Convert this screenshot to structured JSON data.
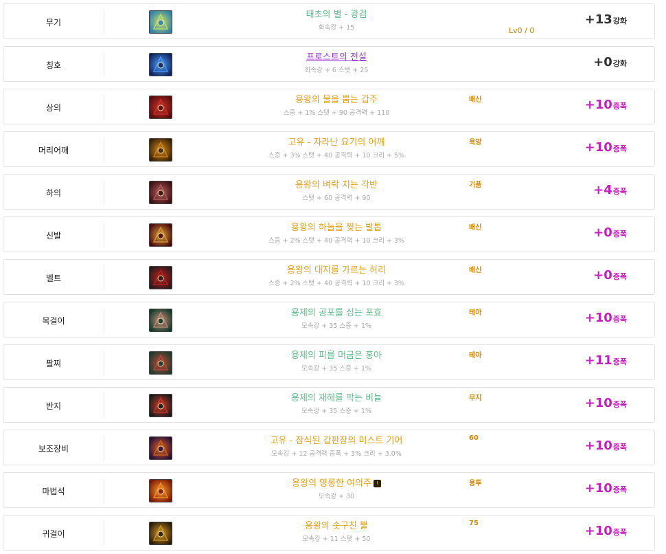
{
  "rows": [
    {
      "slot": "무기",
      "name": "태초의 별 - 광검",
      "name_color": "green",
      "stats": "화속강 + 15",
      "option": "",
      "level": "Lv0 / 0",
      "enhance": "+13",
      "unit": "강화",
      "enh_color": "black",
      "icon": "weapon-icon",
      "c1": "#2f7fa8",
      "c2": "#c9e36a",
      "warning": false
    },
    {
      "slot": "칭호",
      "name": "프로스트의 전설",
      "name_color": "purple",
      "stats": "화속강 + 6 스탯 + 25",
      "option": "",
      "level": "",
      "enhance": "+0",
      "unit": "강화",
      "enh_color": "black",
      "icon": "title-icon",
      "c1": "#10245e",
      "c2": "#4fa0ff",
      "warning": false
    },
    {
      "slot": "상의",
      "name": "용왕의 불을 뿜는 갑주",
      "name_color": "gold",
      "stats": "스증 + 1% 스탯 + 90 공격력 + 110",
      "option": "배신",
      "level": "",
      "enhance": "+10",
      "unit": "증폭",
      "enh_color": "magenta",
      "icon": "top-armor-icon",
      "c1": "#5a0d0d",
      "c2": "#d0342c",
      "warning": false
    },
    {
      "slot": "머리어깨",
      "name": "고유 - 자라난 요기의 어깨",
      "name_color": "gold",
      "stats": "스증 + 3% 스탯 + 40 공격력 + 10 크리 + 5%",
      "option": "욕망",
      "level": "",
      "enhance": "+10",
      "unit": "증폭",
      "enh_color": "magenta",
      "icon": "shoulder-icon",
      "c1": "#3a2206",
      "c2": "#d98a1c",
      "warning": false
    },
    {
      "slot": "하의",
      "name": "용왕의 벼락 치는 각반",
      "name_color": "gold",
      "stats": "스탯 + 60 공격력 + 90",
      "option": "기품",
      "level": "",
      "enhance": "+4",
      "unit": "증폭",
      "enh_color": "magenta",
      "icon": "pants-icon",
      "c1": "#3b1010",
      "c2": "#b86060",
      "warning": false
    },
    {
      "slot": "신발",
      "name": "용왕의 하늘을 찢는 발톱",
      "name_color": "gold",
      "stats": "스증 + 2% 스탯 + 40 공격력 + 10 크리 + 3%",
      "option": "배신",
      "level": "",
      "enhance": "+0",
      "unit": "증폭",
      "enh_color": "magenta",
      "icon": "shoes-icon",
      "c1": "#4a0c0c",
      "c2": "#e0a23a",
      "warning": false
    },
    {
      "slot": "벨트",
      "name": "용왕의 대지를 가르는 허리",
      "name_color": "gold",
      "stats": "스증 + 2% 스탯 + 40 공격력 + 10 크리 + 3%",
      "option": "배신",
      "level": "",
      "enhance": "+0",
      "unit": "증폭",
      "enh_color": "magenta",
      "icon": "belt-icon",
      "c1": "#2a1a1a",
      "c2": "#c02020",
      "warning": false
    },
    {
      "slot": "목걸이",
      "name": "용제의 공포를 심는 포효",
      "name_color": "green",
      "stats": "모속강 + 35 스증 + 1%",
      "option": "테아",
      "level": "",
      "enhance": "+10",
      "unit": "증폭",
      "enh_color": "magenta",
      "icon": "necklace-icon",
      "c1": "#133a2c",
      "c2": "#c98f7a",
      "warning": false
    },
    {
      "slot": "팔찌",
      "name": "용제의 피를 머금은 홍아",
      "name_color": "green",
      "stats": "모속강 + 35 스증 + 1%",
      "option": "테아",
      "level": "",
      "enhance": "+11",
      "unit": "증폭",
      "enh_color": "magenta",
      "icon": "bracelet-icon",
      "c1": "#1f3b2d",
      "c2": "#c24a3a",
      "warning": false
    },
    {
      "slot": "반지",
      "name": "용제의 재해를 막는 비늘",
      "name_color": "green",
      "stats": "모속강 + 35 스증 + 1%",
      "option": "무지",
      "level": "",
      "enhance": "+10",
      "unit": "증폭",
      "enh_color": "magenta",
      "icon": "ring-icon",
      "c1": "#1b1b1b",
      "c2": "#d23a2a",
      "warning": false
    },
    {
      "slot": "보조장비",
      "name": "고유 - 잠식된 갑판장의 미스트 기어",
      "name_color": "gold",
      "stats": "모속강 + 12 공격력 증폭 + 3% 크리 + 3.0%",
      "option": "60",
      "level": "",
      "enhance": "+10",
      "unit": "증폭",
      "enh_color": "magenta",
      "icon": "sub-equipment-icon",
      "c1": "#2a0f3a",
      "c2": "#e0661c",
      "warning": false
    },
    {
      "slot": "마법석",
      "name": "용왕의 영롱한 여의주",
      "name_color": "gold",
      "stats": "모속강 + 30",
      "option": "용투",
      "level": "",
      "enhance": "+10",
      "unit": "증폭",
      "enh_color": "magenta",
      "icon": "magic-stone-icon",
      "c1": "#7a1a05",
      "c2": "#ff9a2c",
      "warning": true,
      "warning_mark": "!"
    },
    {
      "slot": "귀걸이",
      "name": "용왕의 솟구친 뿔",
      "name_color": "gold",
      "stats": "모속강 + 11 스탯 + 50",
      "option": "75",
      "level": "",
      "enhance": "+10",
      "unit": "증폭",
      "enh_color": "magenta",
      "icon": "earring-icon",
      "c1": "#2a1c06",
      "c2": "#d89c2c",
      "warning": false
    }
  ]
}
